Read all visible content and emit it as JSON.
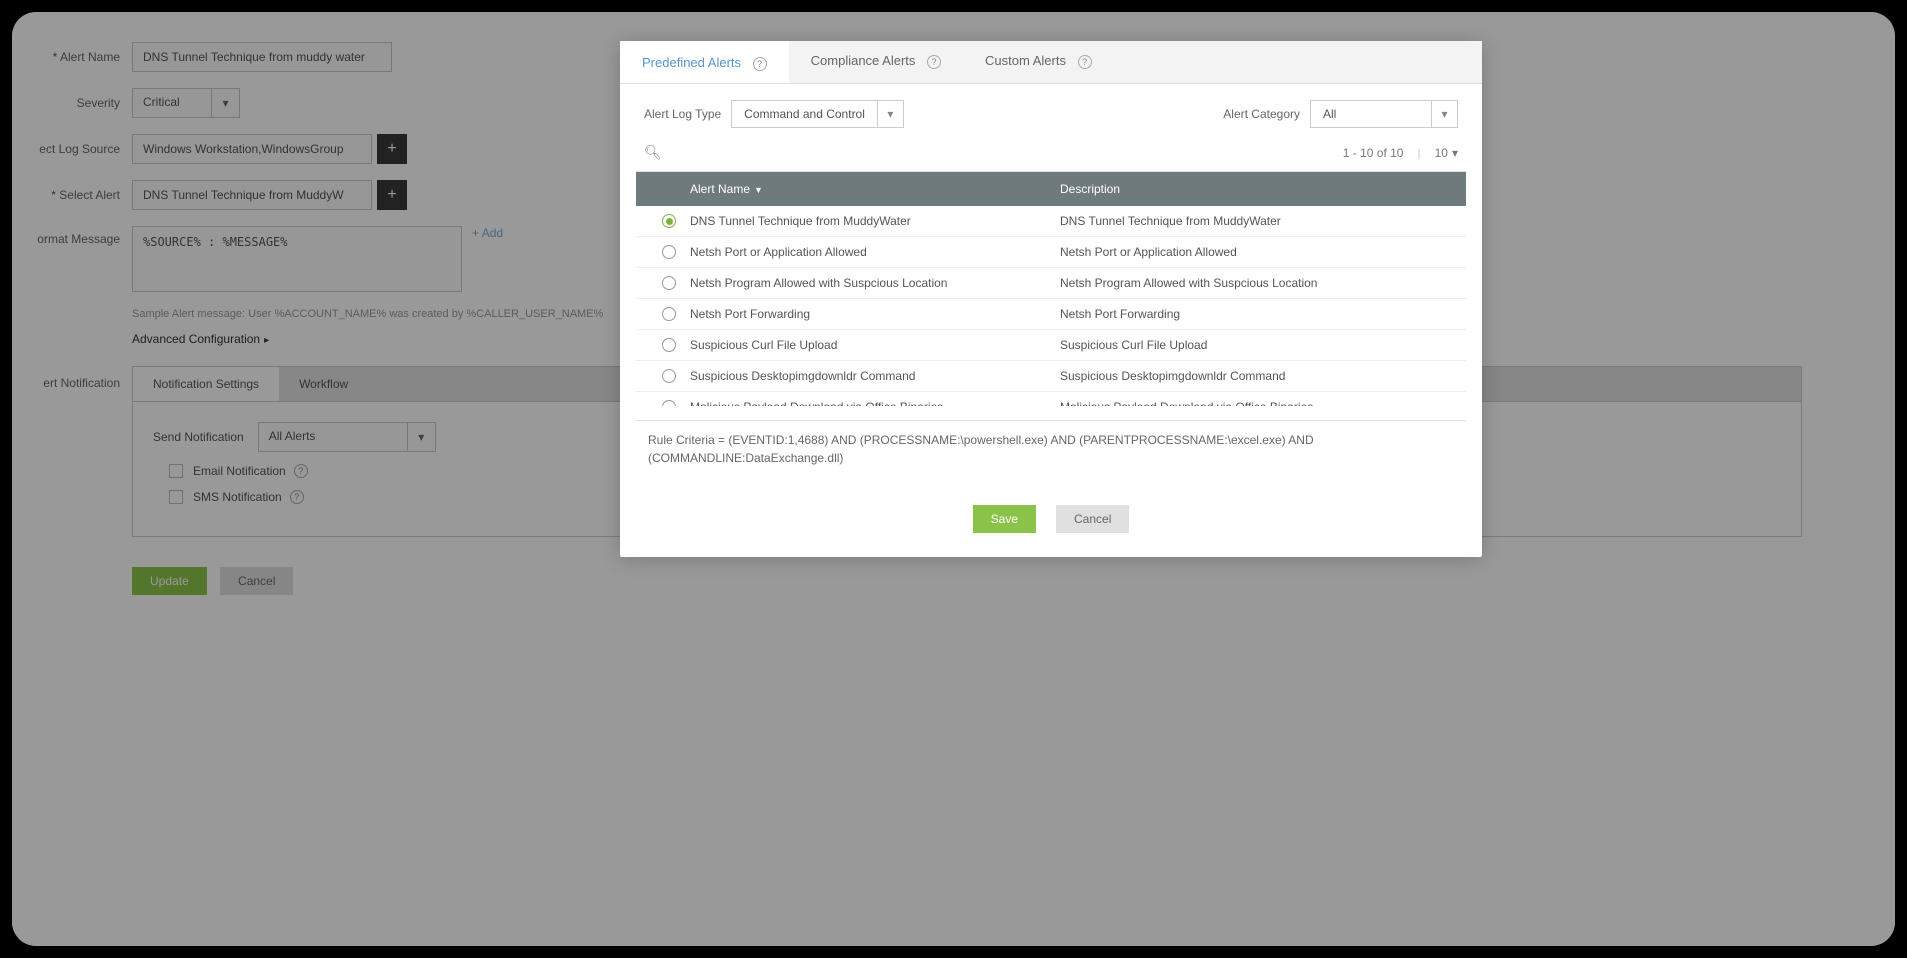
{
  "form": {
    "alert_name_label": "Alert Name",
    "alert_name_value": "DNS Tunnel Technique from muddy water",
    "severity_label": "Severity",
    "severity_value": "Critical",
    "log_source_label": "ect Log Source",
    "log_source_value": "Windows Workstation,WindowsGroup",
    "select_alert_label": "Select Alert",
    "select_alert_value": "DNS Tunnel Technique from MuddyW",
    "format_message_label": "ormat Message",
    "format_message_value": "%SOURCE% : %MESSAGE%",
    "add_link": "Add",
    "sample_hint": "Sample Alert message: User %ACCOUNT_NAME% was created by %CALLER_USER_NAME%",
    "adv_conf": "Advanced Configuration",
    "notif_label": "ert Notification",
    "notif_tabs": {
      "settings": "Notification Settings",
      "workflow": "Workflow"
    },
    "send_notif_label": "Send Notification",
    "send_notif_value": "All Alerts",
    "email_notif": "Email Notification",
    "sms_notif": "SMS Notification",
    "update_btn": "Update",
    "cancel_btn": "Cancel"
  },
  "modal": {
    "tabs": {
      "predefined": "Predefined Alerts",
      "compliance": "Compliance Alerts",
      "custom": "Custom Alerts"
    },
    "alert_log_type_label": "Alert Log Type",
    "alert_log_type_value": "Command and Control",
    "alert_category_label": "Alert Category",
    "alert_category_value": "All",
    "pagination": "1 - 10 of 10",
    "page_size": "10",
    "columns": {
      "name": "Alert Name",
      "desc": "Description"
    },
    "rows": [
      {
        "selected": true,
        "name": "DNS Tunnel Technique from MuddyWater",
        "desc": "DNS Tunnel Technique from MuddyWater"
      },
      {
        "selected": false,
        "name": "Netsh Port or Application Allowed",
        "desc": "Netsh Port or Application Allowed"
      },
      {
        "selected": false,
        "name": "Netsh Program Allowed with Suspcious Location",
        "desc": "Netsh Program Allowed with Suspcious Location"
      },
      {
        "selected": false,
        "name": "Netsh Port Forwarding",
        "desc": "Netsh Port Forwarding"
      },
      {
        "selected": false,
        "name": "Suspicious Curl File Upload",
        "desc": "Suspicious Curl File Upload"
      },
      {
        "selected": false,
        "name": "Suspicious Desktopimgdownldr Command",
        "desc": "Suspicious Desktopimgdownldr Command"
      },
      {
        "selected": false,
        "name": "Malicious Payload Download via Office Binaries",
        "desc": "Malicious Payload Download via Office Binaries"
      }
    ],
    "rule_criteria": "Rule Criteria = (EVENTID:1,4688) AND (PROCESSNAME:\\powershell.exe) AND (PARENTPROCESSNAME:\\excel.exe) AND (COMMANDLINE:DataExchange.dll)",
    "save_btn": "Save",
    "cancel_btn": "Cancel"
  }
}
